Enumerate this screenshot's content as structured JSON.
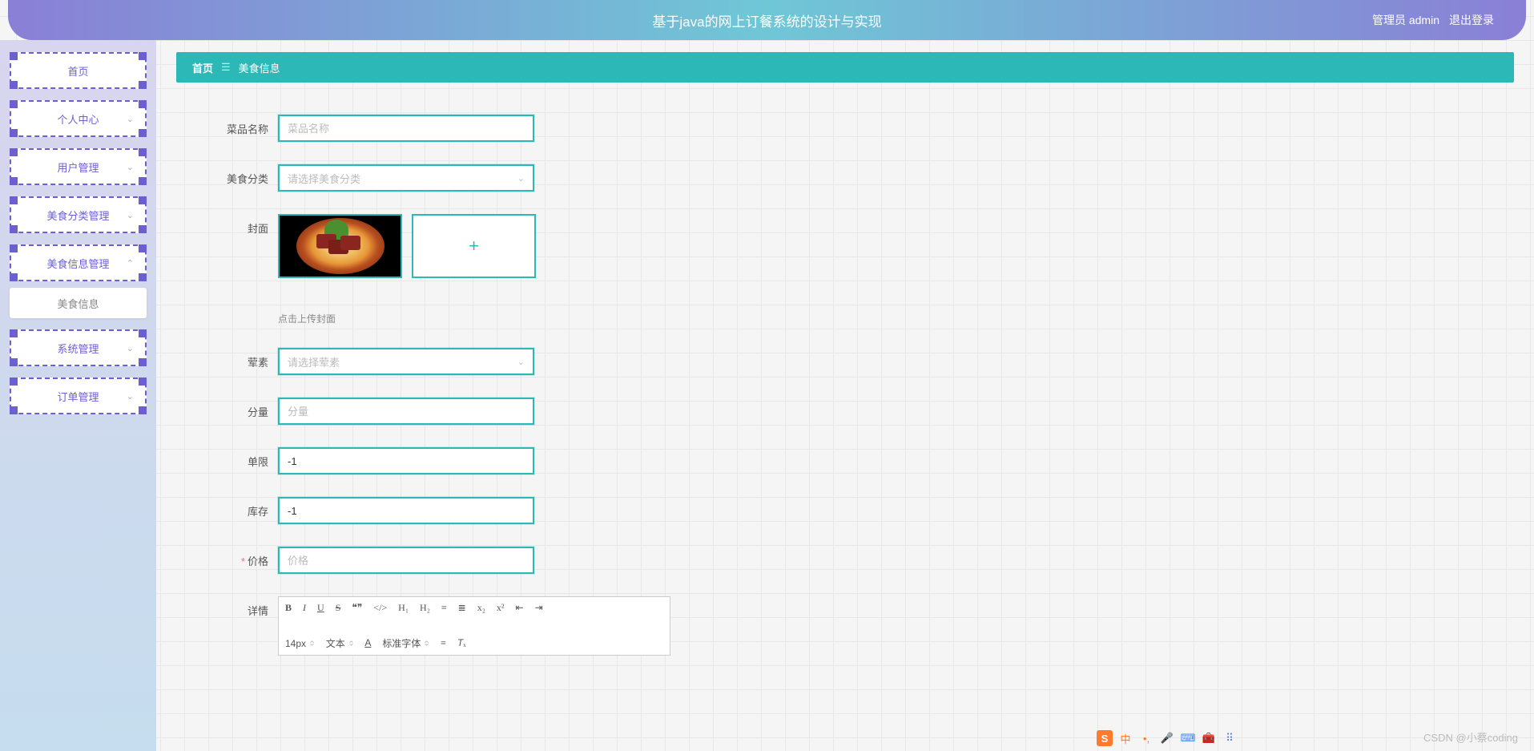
{
  "header": {
    "title": "基于java的网上订餐系统的设计与实现",
    "admin_label": "管理员 admin",
    "logout": "退出登录"
  },
  "sidebar": {
    "items": [
      {
        "label": "首页",
        "expandable": false
      },
      {
        "label": "个人中心",
        "expandable": true
      },
      {
        "label": "用户管理",
        "expandable": true
      },
      {
        "label": "美食分类管理",
        "expandable": true
      },
      {
        "label": "美食信息管理",
        "expandable": true,
        "open": true,
        "sub": "美食信息"
      },
      {
        "label": "系统管理",
        "expandable": true
      },
      {
        "label": "订单管理",
        "expandable": true
      }
    ]
  },
  "breadcrumb": {
    "home": "首页",
    "current": "美食信息"
  },
  "form": {
    "dish_name": {
      "label": "菜品名称",
      "placeholder": "菜品名称",
      "value": ""
    },
    "category": {
      "label": "美食分类",
      "placeholder": "请选择美食分类"
    },
    "cover": {
      "label": "封面",
      "hint": "点击上传封面"
    },
    "veg": {
      "label": "荤素",
      "placeholder": "请选择荤素"
    },
    "portion": {
      "label": "分量",
      "placeholder": "分量",
      "value": ""
    },
    "limit": {
      "label": "单限",
      "value": "-1"
    },
    "stock": {
      "label": "库存",
      "value": "-1"
    },
    "price": {
      "label": "价格",
      "placeholder": "价格",
      "value": "",
      "required": true
    },
    "detail": {
      "label": "详情"
    }
  },
  "editor": {
    "font_size": "14px",
    "font_family": "文本",
    "font_face": "标准字体"
  },
  "watermark": "CSDN @小蔡coding",
  "ime": {
    "cn": "中"
  }
}
